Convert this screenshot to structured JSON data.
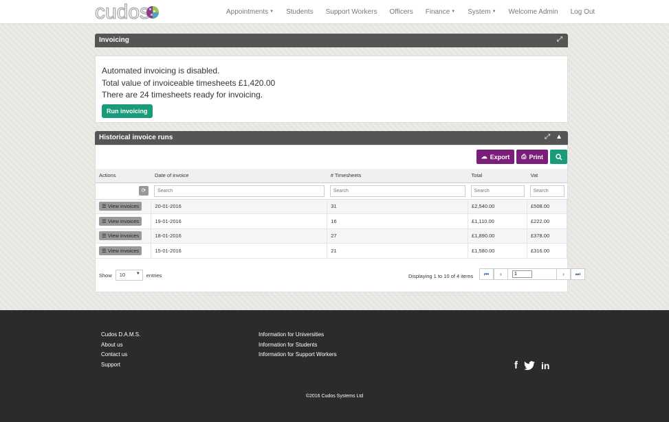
{
  "brand": {
    "logo_text": "cudos"
  },
  "nav": {
    "items": [
      {
        "label": "Appointments",
        "dropdown": true
      },
      {
        "label": "Students",
        "dropdown": false
      },
      {
        "label": "Support Workers",
        "dropdown": false
      },
      {
        "label": "Officers",
        "dropdown": false
      },
      {
        "label": "Finance",
        "dropdown": true
      },
      {
        "label": "System",
        "dropdown": true
      },
      {
        "label": "Welcome Admin",
        "dropdown": false
      },
      {
        "label": "Log Out",
        "dropdown": false
      }
    ]
  },
  "invoicing": {
    "title": "Invoicing",
    "status": "Automated invoicing is disabled.",
    "total_value": "Total value of invoiceable timesheets £1,420.00",
    "ready": "There are 24 timesheets ready for invoicing.",
    "run_button": "Run invoicing"
  },
  "history": {
    "title": "Historical invoice runs",
    "export_label": "Export",
    "print_label": "Print",
    "columns": [
      "Actions",
      "Date of invoice",
      "# Timesheets",
      "Total",
      "Vat"
    ],
    "search_placeholder": "Search",
    "view_label": "View invoices",
    "rows": [
      {
        "date": "20-01-2016",
        "timesheets": "31",
        "total": "£2,540.00",
        "vat": "£508.00"
      },
      {
        "date": "19-01-2016",
        "timesheets": "16",
        "total": "£1,110.00",
        "vat": "£222.00"
      },
      {
        "date": "18-01-2016",
        "timesheets": "27",
        "total": "£1,890.00",
        "vat": "£378.00"
      },
      {
        "date": "15-01-2016",
        "timesheets": "21",
        "total": "£1,580.00",
        "vat": "£316.00"
      }
    ],
    "show_label": "Show",
    "entries_value": "10",
    "entries_label": "entries",
    "displaying": "Displaying 1 to 10 of 4 items",
    "page_value": "1"
  },
  "footer": {
    "col1": [
      "Cudos D.A.M.S.",
      "About us",
      "Contact us",
      "Support"
    ],
    "col2": [
      "Information for Universities",
      "Information for Students",
      "Information for Support Workers"
    ],
    "copyright": "©2016 Cudos Systems Ltd",
    "socials": [
      "facebook-icon",
      "twitter-icon",
      "linkedin-icon"
    ]
  },
  "colors": {
    "accent_green": "#1a9c7b",
    "accent_purple": "#7b1e7a",
    "panel_header": "#555555",
    "footer_bg": "#2b2b2b"
  }
}
